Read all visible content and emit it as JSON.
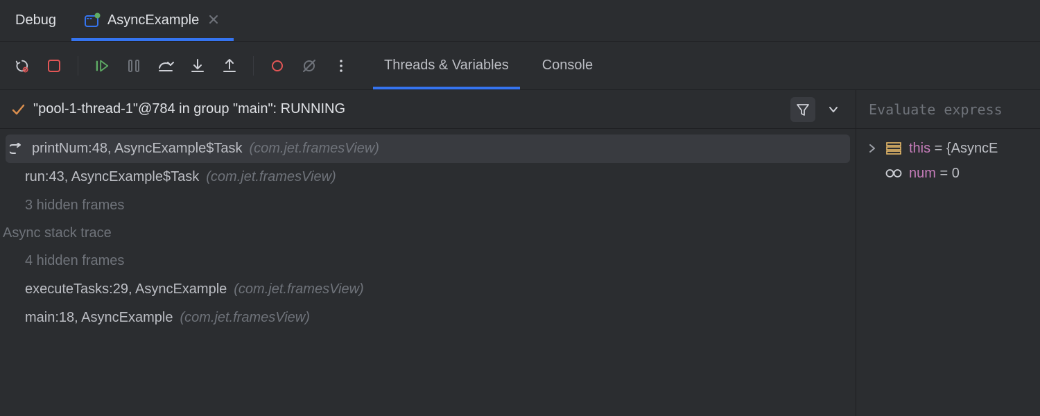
{
  "header": {
    "title": "Debug",
    "tab": {
      "label": "AsyncExample"
    }
  },
  "toolbar": {
    "tabs": {
      "threads": "Threads & Variables",
      "console": "Console"
    }
  },
  "thread": {
    "text": "\"pool-1-thread-1\"@784 in group \"main\": RUNNING"
  },
  "frames": {
    "f0": {
      "main": "printNum:48, AsyncExample$Task ",
      "pkg": "(com.jet.framesView)"
    },
    "f1": {
      "main": "run:43, AsyncExample$Task ",
      "pkg": "(com.jet.framesView)"
    },
    "hidden1": "3 hidden frames",
    "section": "Async stack trace",
    "hidden2": "4 hidden frames",
    "f2": {
      "main": "executeTasks:29, AsyncExample ",
      "pkg": "(com.jet.framesView)"
    },
    "f3": {
      "main": "main:18, AsyncExample ",
      "pkg": "(com.jet.framesView)"
    }
  },
  "vars": {
    "placeholder": "Evaluate express",
    "v0": {
      "name": "this",
      "val": " = {AsyncE"
    },
    "v1": {
      "name": "num",
      "val": " = 0"
    }
  }
}
